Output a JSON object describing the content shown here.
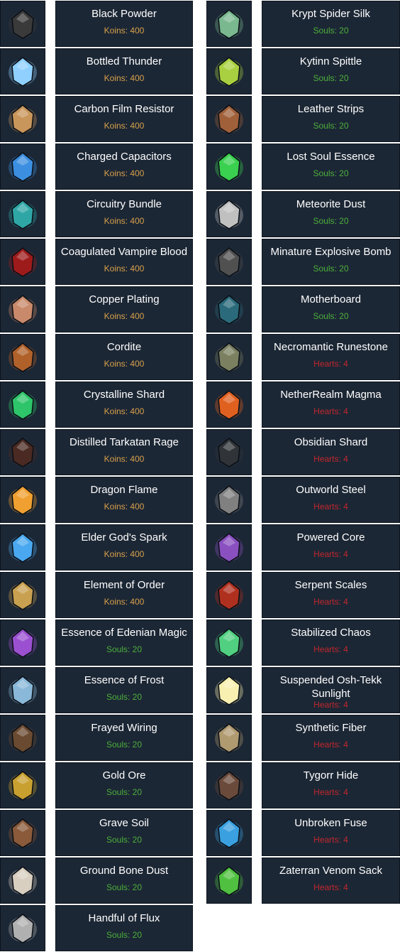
{
  "left_items": [
    {
      "name": "Black Powder",
      "cost": "Koins: 400",
      "currency": "koins",
      "icon": "black-powder-icon",
      "color": "#3a3a3a"
    },
    {
      "name": "Bottled Thunder",
      "cost": "Koins: 400",
      "currency": "koins",
      "icon": "bottled-thunder-icon",
      "color": "#8fd0ff"
    },
    {
      "name": "Carbon Film Resistor",
      "cost": "Koins: 400",
      "currency": "koins",
      "icon": "carbon-film-resistor-icon",
      "color": "#c8955a"
    },
    {
      "name": "Charged Capacitors",
      "cost": "Koins: 400",
      "currency": "koins",
      "icon": "charged-capacitors-icon",
      "color": "#3c8fe0"
    },
    {
      "name": "Circuitry Bundle",
      "cost": "Koins: 400",
      "currency": "koins",
      "icon": "circuitry-bundle-icon",
      "color": "#2fa6a6"
    },
    {
      "name": "Coagulated Vampire Blood",
      "cost": "Koins: 400",
      "currency": "koins",
      "icon": "vampire-blood-icon",
      "color": "#9e1b1b"
    },
    {
      "name": "Copper Plating",
      "cost": "Koins: 400",
      "currency": "koins",
      "icon": "copper-plating-icon",
      "color": "#c88a6a"
    },
    {
      "name": "Cordite",
      "cost": "Koins: 400",
      "currency": "koins",
      "icon": "cordite-icon",
      "color": "#b0612a"
    },
    {
      "name": "Crystalline Shard",
      "cost": "Koins: 400",
      "currency": "koins",
      "icon": "crystalline-shard-icon",
      "color": "#2ec46a"
    },
    {
      "name": "Distilled Tarkatan Rage",
      "cost": "Koins: 400",
      "currency": "koins",
      "icon": "tarkatan-rage-icon",
      "color": "#4a2a22"
    },
    {
      "name": "Dragon Flame",
      "cost": "Koins: 400",
      "currency": "koins",
      "icon": "dragon-flame-icon",
      "color": "#f0a030"
    },
    {
      "name": "Elder God's Spark",
      "cost": "Koins: 400",
      "currency": "koins",
      "icon": "elder-gods-spark-icon",
      "color": "#4aa8f0"
    },
    {
      "name": "Element of Order",
      "cost": "Koins: 400",
      "currency": "koins",
      "icon": "element-of-order-icon",
      "color": "#c8a050"
    },
    {
      "name": "Essence of Edenian Magic",
      "cost": "Souls: 20",
      "currency": "souls",
      "icon": "edenian-magic-icon",
      "color": "#9a50d0"
    },
    {
      "name": "Essence of Frost",
      "cost": "Souls: 20",
      "currency": "souls",
      "icon": "essence-of-frost-icon",
      "color": "#8ab8d8"
    },
    {
      "name": "Frayed Wiring",
      "cost": "Souls: 20",
      "currency": "souls",
      "icon": "frayed-wiring-icon",
      "color": "#6a4a30"
    },
    {
      "name": "Gold Ore",
      "cost": "Souls: 20",
      "currency": "souls",
      "icon": "gold-ore-icon",
      "color": "#c8a030"
    },
    {
      "name": "Grave Soil",
      "cost": "Souls: 20",
      "currency": "souls",
      "icon": "grave-soil-icon",
      "color": "#8a5a3a"
    },
    {
      "name": "Ground Bone Dust",
      "cost": "Souls: 20",
      "currency": "souls",
      "icon": "bone-dust-icon",
      "color": "#d8cfc0"
    },
    {
      "name": "Handful of Flux",
      "cost": "Souls: 20",
      "currency": "souls",
      "icon": "handful-of-flux-icon",
      "color": "#b0b0b0"
    }
  ],
  "right_items": [
    {
      "name": "Krypt Spider Silk",
      "cost": "Souls: 20",
      "currency": "souls",
      "icon": "krypt-spider-silk-icon",
      "color": "#7ab890"
    },
    {
      "name": "Kytinn Spittle",
      "cost": "Souls: 20",
      "currency": "souls",
      "icon": "kytinn-spittle-icon",
      "color": "#a8d040"
    },
    {
      "name": "Leather Strips",
      "cost": "Souls: 20",
      "currency": "souls",
      "icon": "leather-strips-icon",
      "color": "#a0603a"
    },
    {
      "name": "Lost Soul Essence",
      "cost": "Souls: 20",
      "currency": "souls",
      "icon": "lost-soul-essence-icon",
      "color": "#3ad050"
    },
    {
      "name": "Meteorite Dust",
      "cost": "Souls: 20",
      "currency": "souls",
      "icon": "meteorite-dust-icon",
      "color": "#c0c0c0"
    },
    {
      "name": "Minature Explosive Bomb",
      "cost": "Souls: 20",
      "currency": "souls",
      "icon": "explosive-bomb-icon",
      "color": "#505050"
    },
    {
      "name": "Motherboard",
      "cost": "Souls: 20",
      "currency": "souls",
      "icon": "motherboard-icon",
      "color": "#2a6a7a"
    },
    {
      "name": "Necromantic Runestone",
      "cost": "Hearts: 4",
      "currency": "hearts",
      "icon": "necromantic-runestone-icon",
      "color": "#7a8060"
    },
    {
      "name": "NetherRealm Magma",
      "cost": "Hearts: 4",
      "currency": "hearts",
      "icon": "netherrealm-magma-icon",
      "color": "#e06020"
    },
    {
      "name": "Obsidian Shard",
      "cost": "Hearts: 4",
      "currency": "hearts",
      "icon": "obsidian-shard-icon",
      "color": "#303438"
    },
    {
      "name": "Outworld Steel",
      "cost": "Hearts: 4",
      "currency": "hearts",
      "icon": "outworld-steel-icon",
      "color": "#808080"
    },
    {
      "name": "Powered Core",
      "cost": "Hearts: 4",
      "currency": "hearts",
      "icon": "powered-core-icon",
      "color": "#8a50c0"
    },
    {
      "name": "Serpent Scales",
      "cost": "Hearts: 4",
      "currency": "hearts",
      "icon": "serpent-scales-icon",
      "color": "#b03020"
    },
    {
      "name": "Stabilized Chaos",
      "cost": "Hearts: 4",
      "currency": "hearts",
      "icon": "stabilized-chaos-icon",
      "color": "#50d080"
    },
    {
      "name": "Suspended Osh-Tekk Sunlight",
      "cost": "Hearts: 4",
      "currency": "hearts",
      "icon": "osh-tekk-sunlight-icon",
      "color": "#f8f0b0"
    },
    {
      "name": "Synthetic Fiber",
      "cost": "Hearts: 4",
      "currency": "hearts",
      "icon": "synthetic-fiber-icon",
      "color": "#b09a70"
    },
    {
      "name": "Tygorr Hide",
      "cost": "Hearts: 4",
      "currency": "hearts",
      "icon": "tygorr-hide-icon",
      "color": "#6a4a3a"
    },
    {
      "name": "Unbroken Fuse",
      "cost": "Hearts: 4",
      "currency": "hearts",
      "icon": "unbroken-fuse-icon",
      "color": "#3aa0e0"
    },
    {
      "name": "Zaterran Venom Sack",
      "cost": "Hearts: 4",
      "currency": "hearts",
      "icon": "zaterran-venom-sack-icon",
      "color": "#50c040"
    }
  ]
}
